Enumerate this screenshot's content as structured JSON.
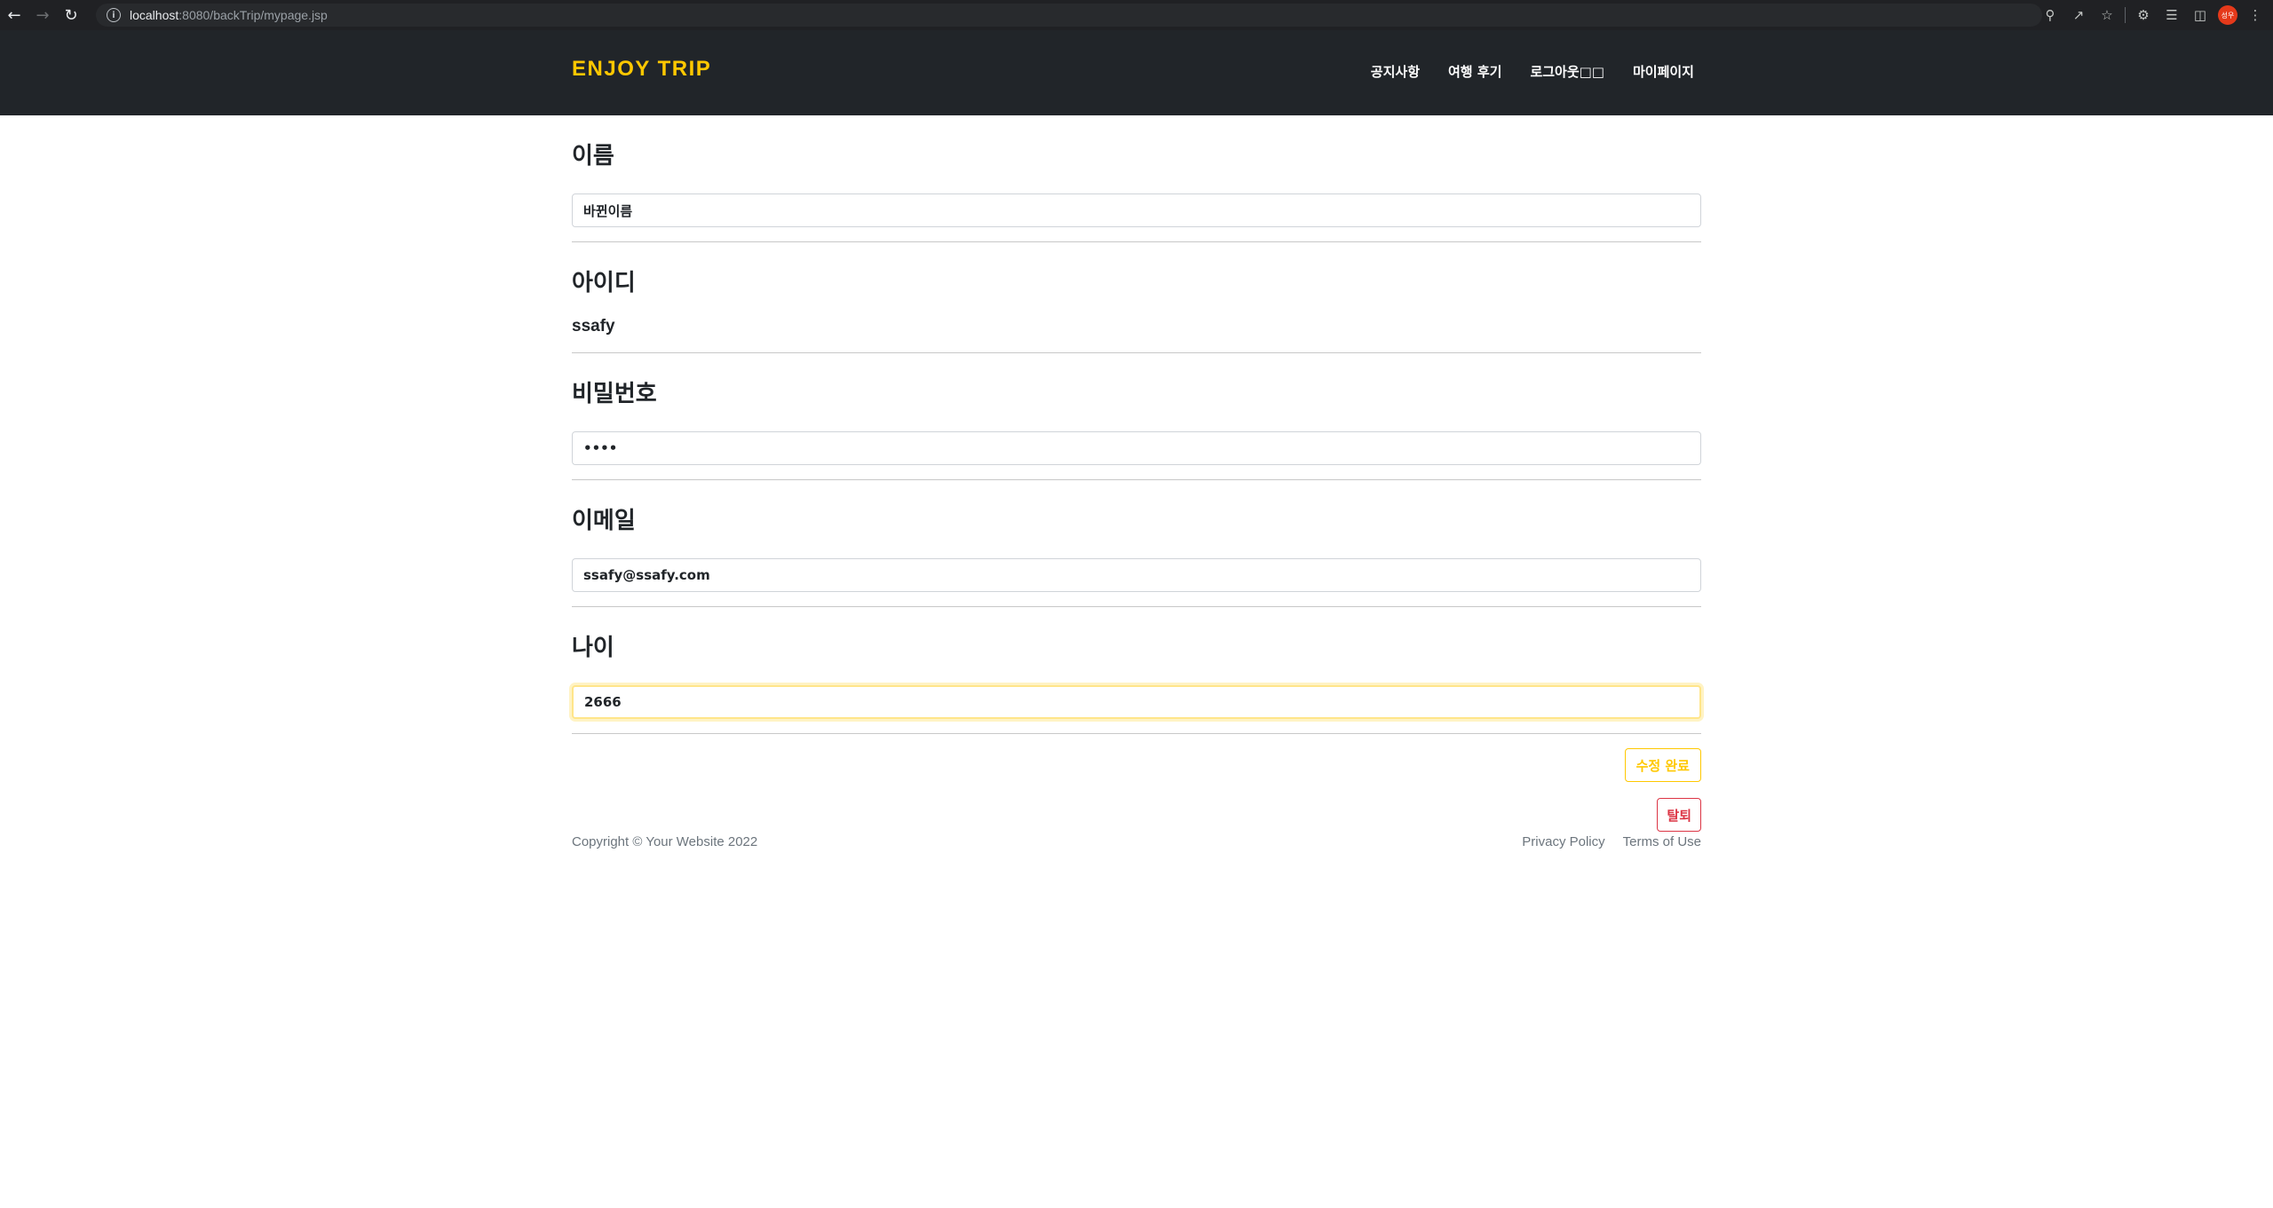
{
  "browser": {
    "url_host": "localhost",
    "url_rest": ":8080/backTrip/mypage.jsp",
    "profile_initials": "성우"
  },
  "header": {
    "brand": "ENJOY TRIP",
    "nav": [
      "공지사항",
      "여행 후기",
      "로그아웃□□",
      "마이페이지"
    ]
  },
  "form": {
    "name_label": "이름",
    "name_value": "바뀐이름",
    "id_label": "아이디",
    "id_value": "ssafy",
    "password_label": "비밀번호",
    "password_value": "••••",
    "email_label": "이메일",
    "email_value": "ssafy@ssafy.com",
    "age_label": "나이",
    "age_value": "2666",
    "save_label": "수정 완료",
    "delete_label": "탈퇴"
  },
  "footer": {
    "copyright": "Copyright © Your Website 2022",
    "privacy": "Privacy Policy",
    "terms": "Terms of Use"
  },
  "colors": {
    "accent": "#ffc800",
    "header_bg": "#212529",
    "danger": "#dc3545"
  }
}
